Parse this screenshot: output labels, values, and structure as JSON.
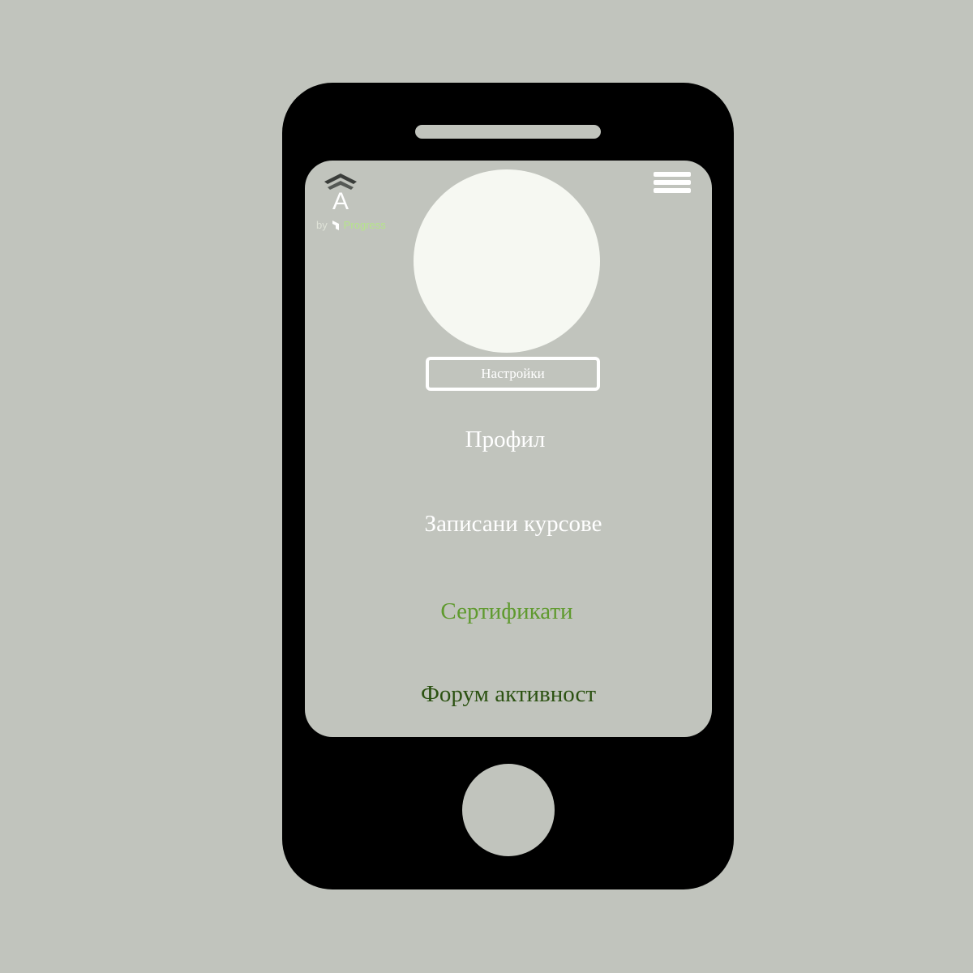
{
  "logo": {
    "letter": "A",
    "by": "by",
    "brand": "Progress"
  },
  "profile": {
    "settings_label": "Настройки"
  },
  "nav": {
    "items": [
      {
        "label": "Профил",
        "color": "#ffffff"
      },
      {
        "label": "Записани курсове",
        "color": "#ffffff"
      },
      {
        "label": "Сертификати",
        "color": "#5f9a2e"
      },
      {
        "label": "Форум активност",
        "color": "#2c5212"
      }
    ]
  },
  "icons": {
    "logo": "chevrons-logo-icon",
    "menu": "hamburger-menu-icon",
    "progress_mark": "progress-mark-icon"
  },
  "colors": {
    "background": "#c1c4bd",
    "device": "#000000",
    "avatar": "#f6f8f2",
    "accent_green": "#5f9a2e",
    "dark_green": "#2c5212"
  }
}
